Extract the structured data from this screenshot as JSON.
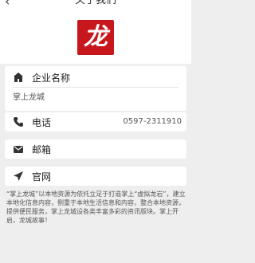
{
  "header": {
    "back_icon": "chevron-left-icon",
    "title": "关于我们"
  },
  "logo": {
    "glyph": "龙",
    "background": "#c8161d"
  },
  "company": {
    "label": "企业名称",
    "value": "掌上龙城",
    "icon": "building-icon"
  },
  "phone": {
    "label": "电话",
    "value": "0597-2311910",
    "icon": "phone-icon"
  },
  "email": {
    "label": "邮箱",
    "icon": "mail-icon"
  },
  "website": {
    "label": "官网",
    "icon": "location-arrow-icon"
  },
  "description": "“掌上龙城”以本地资源为依托立足于打造掌上“虚拟龙岩”，建立本地化信息内容，侧重于本地生活信息和内容，整合本地资源，提供便民服务，掌上龙城设各类丰富多彩的资讯版块。掌上开启，龙城故事！"
}
